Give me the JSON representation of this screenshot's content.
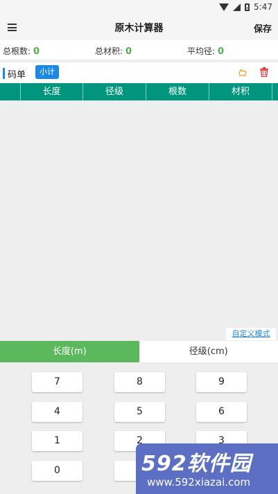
{
  "status": {
    "time": "5:47"
  },
  "appbar": {
    "title": "原木计算器",
    "save_label": "保存"
  },
  "summary": [
    {
      "label": "总根数:",
      "value": "0"
    },
    {
      "label": "总材积:",
      "value": "0"
    },
    {
      "label": "平均径:",
      "value": "0"
    }
  ],
  "code": {
    "title": "码单",
    "subtotal_label": "小计"
  },
  "table": {
    "columns": [
      "",
      "长度",
      "径级",
      "根数",
      "材积",
      ""
    ]
  },
  "custom_mode_label": "自定义模式",
  "modes": [
    {
      "label": "长度(m)",
      "active": true
    },
    {
      "label": "径级(cm)",
      "active": false
    }
  ],
  "keys": [
    "7",
    "8",
    "9",
    "4",
    "5",
    "6",
    "1",
    "2",
    "3",
    "0"
  ],
  "watermark": {
    "brand": "592软件园",
    "url": "www.592xiazai.com"
  },
  "colors": {
    "table_header": "#00967d",
    "active_tab": "#5cb85c",
    "accent": "#1e88e5",
    "value_green": "#4caf50"
  }
}
